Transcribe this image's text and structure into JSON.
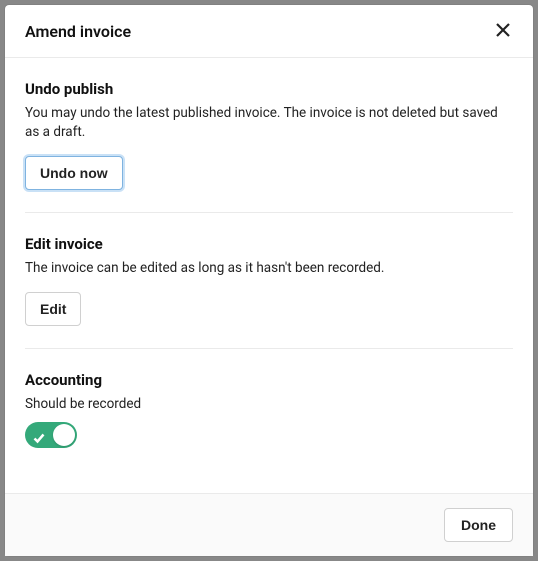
{
  "modal": {
    "title": "Amend invoice",
    "footer": {
      "done_label": "Done"
    }
  },
  "sections": {
    "undo": {
      "title": "Undo publish",
      "desc": "You may undo the latest published invoice. The invoice is not deleted but saved as a draft.",
      "button_label": "Undo now"
    },
    "edit": {
      "title": "Edit invoice",
      "desc": "The invoice can be edited as long as it hasn't been recorded.",
      "button_label": "Edit"
    },
    "accounting": {
      "title": "Accounting",
      "desc": "Should be recorded",
      "toggle_on": true
    }
  }
}
